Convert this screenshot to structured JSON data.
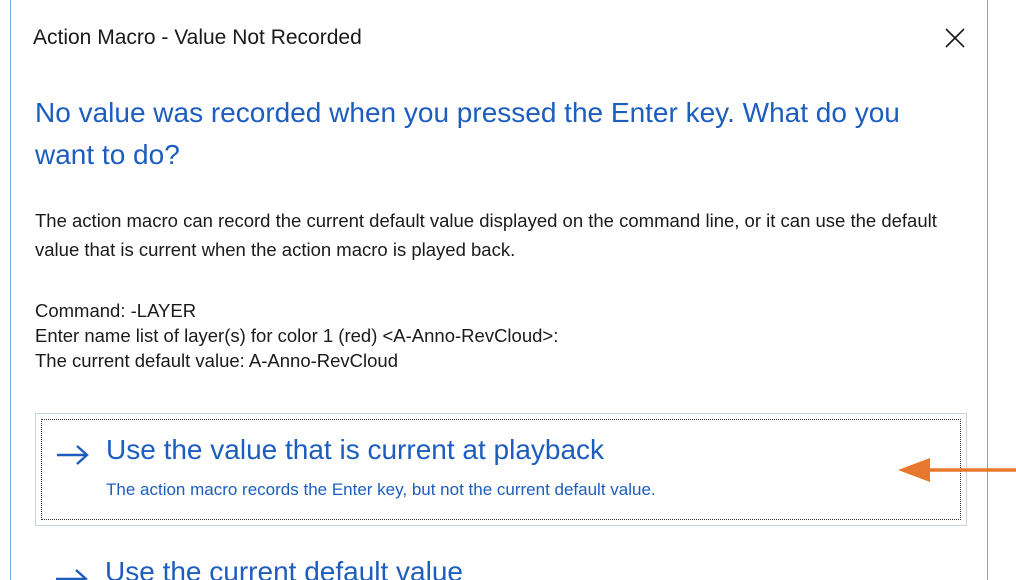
{
  "dialog": {
    "title": "Action Macro - Value Not Recorded",
    "heading": "No value was recorded when you pressed the Enter key. What do you want to do?",
    "description": "The action macro can record the current default value displayed on the command line, or it can use the default value that is current when the action macro is played back.",
    "command_lines": [
      "Command: -LAYER",
      "Enter name list of layer(s) for color 1 (red) <A-Anno-RevCloud>:",
      "The current default value: A-Anno-RevCloud"
    ],
    "options": [
      {
        "label": "Use the value that is current at playback",
        "sublabel": "The action macro records the Enter key, but not the current default value."
      },
      {
        "label": "Use the current default value"
      }
    ]
  },
  "icons": {
    "close": "close-icon",
    "option_arrow": "arrow-right-icon",
    "callout": "callout-arrow-icon"
  },
  "colors": {
    "accent_blue": "#1c5dbf",
    "callout_orange": "#e8772e",
    "window_border": "#7aa7d8"
  }
}
